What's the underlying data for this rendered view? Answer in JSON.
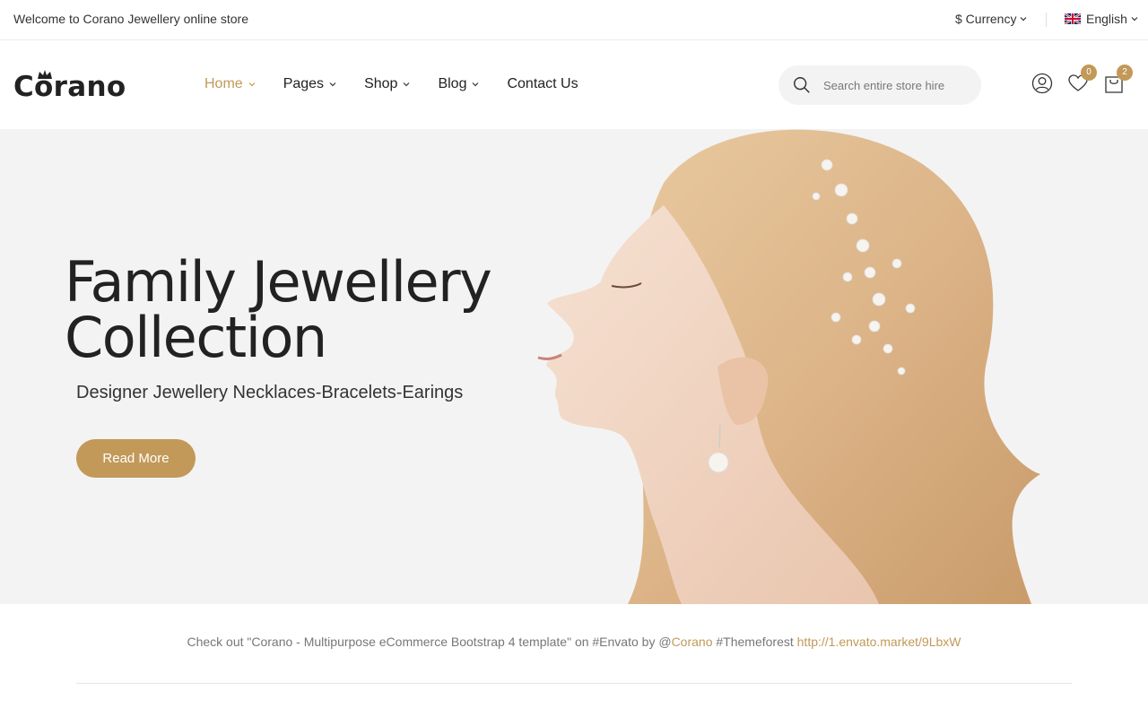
{
  "topbar": {
    "welcome": "Welcome to Corano Jewellery online store",
    "currency_label": "$ Currency",
    "language_label": "English"
  },
  "header": {
    "logo_text": "Corano",
    "nav": [
      {
        "label": "Home",
        "active": true
      },
      {
        "label": "Pages"
      },
      {
        "label": "Shop"
      },
      {
        "label": "Blog"
      },
      {
        "label": "Contact Us"
      }
    ],
    "search": {
      "placeholder": "Search entire store hire"
    },
    "wishlist_count": "0",
    "cart_count": "2"
  },
  "hero": {
    "title_line1": "Family Jewellery",
    "title_line2": "Collection",
    "subtitle": "Designer Jewellery Necklaces-Bracelets-Earings",
    "button_label": "Read More"
  },
  "credit": {
    "prefix": "Check out \"Corano - Multipurpose eCommerce Bootstrap 4 template\" on #Envato by @",
    "author_link": "Corano",
    "middle": " #Themeforest ",
    "url_link": "http://1.envato.market/9LbxW"
  },
  "colors": {
    "accent": "#c29958",
    "hero_bg": "#f3f3f3",
    "text": "#222222"
  },
  "icons": [
    "chevron-down-icon",
    "flag-uk-icon",
    "search-icon",
    "user-icon",
    "heart-icon",
    "cart-icon",
    "crown-icon"
  ]
}
